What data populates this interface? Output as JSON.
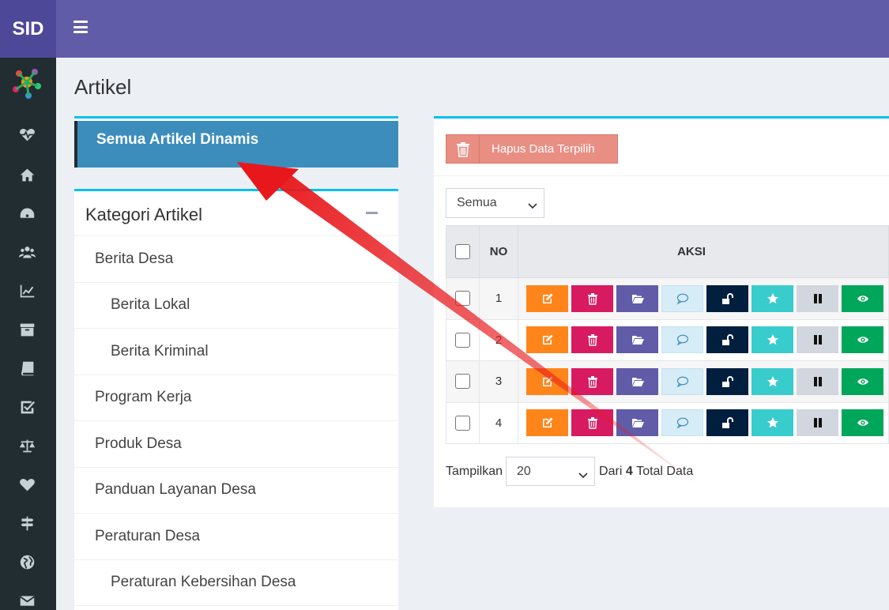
{
  "brand": {
    "label": "SID"
  },
  "page": {
    "title": "Artikel"
  },
  "semua": {
    "label": "Semua Artikel Dinamis"
  },
  "kategori": {
    "title": "Kategori Artikel",
    "items": [
      {
        "label": "Berita Desa",
        "level": 0
      },
      {
        "label": "Berita Lokal",
        "level": 1
      },
      {
        "label": "Berita Kriminal",
        "level": 1
      },
      {
        "label": "Program Kerja",
        "level": 0
      },
      {
        "label": "Produk Desa",
        "level": 0
      },
      {
        "label": "Panduan Layanan Desa",
        "level": 0
      },
      {
        "label": "Peraturan Desa",
        "level": 0
      },
      {
        "label": "Peraturan Kebersihan Desa",
        "level": 1
      }
    ]
  },
  "toolbar": {
    "hapus_label": "Hapus Data Terpilih"
  },
  "filter": {
    "selected": "Semua"
  },
  "table": {
    "headers": {
      "no": "NO",
      "aksi": "AKSI"
    },
    "rows": [
      {
        "no": "1"
      },
      {
        "no": "2"
      },
      {
        "no": "3"
      },
      {
        "no": "4"
      }
    ]
  },
  "pagination": {
    "prefix": "Tampilkan",
    "per_page": "20",
    "dari": "Dari",
    "total": "4",
    "suffix": "Total Data"
  },
  "colors": {
    "header": "#605ca8",
    "sidebar": "#222d32",
    "active_item": "#3c8dbc",
    "box_top": "#00c0ef",
    "annotation_arrow": "#e8171b"
  },
  "icons": {
    "sidebar": [
      "heartbeat-icon",
      "home-icon",
      "dashboard-icon",
      "users-icon",
      "line-chart-icon",
      "archive-icon",
      "book-icon",
      "check-square-icon",
      "balance-scale-icon",
      "heart-icon",
      "signpost-icon",
      "globe-icon",
      "envelope-icon"
    ],
    "actions": [
      "edit-icon",
      "trash-icon",
      "folder-open-icon",
      "comment-icon",
      "unlock-icon",
      "star-icon",
      "pause-icon",
      "eye-icon"
    ]
  }
}
